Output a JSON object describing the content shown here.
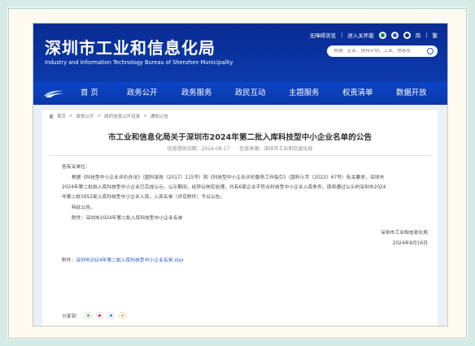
{
  "header": {
    "title": "深圳市工业和信息化局",
    "subtitle": "Industry and Information Technology Bureau of Shenzhen Municipality",
    "top_links": {
      "accessibility": "无障碍浏览",
      "care_mode": "进入关怀版",
      "simplified": "简",
      "traditional": "繁",
      "separator": "|"
    },
    "search": {
      "placeholder": "热搜：企业、扶持计划、工业、信息化"
    }
  },
  "nav": {
    "items": [
      "首 页",
      "政务公开",
      "政务服务",
      "政民互动",
      "主题服务",
      "权责清单",
      "数据开放"
    ]
  },
  "breadcrumb": {
    "items": [
      "首页",
      "政务公开",
      "政府信息公开目录",
      "通知公告"
    ],
    "separator": ">"
  },
  "article": {
    "title": "市工业和信息化局关于深圳市2024年第二批入库科技型中小企业名单的公告",
    "date_label": "信息提供日期：2024-08-17",
    "source_label": "信息来源：深圳市工业和信息化局",
    "greeting": "各有关单位：",
    "body_lines": [
      "根据《科技型中小企业评价办法》（国科发政〔2017〕115号）和《科技型中小企业评价服务工作指引》（国科火字〔2022〕67号）有关要求，深圳市",
      "2024年第二批拟入库科技型中小企业已完成公示。公示期间，经异议核实处理，共有6家企业不符合科技型中小企业入库条件。现将通过公示的深圳市2024",
      "年第二批5952家入库科技型中小企业入库，入库名单（详见附件）予以公告。"
    ],
    "closing": "特此公告。",
    "attachment_note": "附件：深圳市2024年第二批入库科技型中小企业名单",
    "signature": "深圳市工业和信息化局",
    "sign_date": "2024年8月16日",
    "attachment_label": "附件：",
    "attachment_file": "深圳市2024年第二批入库科技型中小企业名单.xlsx",
    "share_label": "分享到："
  },
  "colors": {
    "header_blue": "#0a2b93",
    "nav_blue": "#0c45c8",
    "link_blue": "#1f58c4",
    "background": "#d4ebe6"
  },
  "icons": [
    "weibo-icon",
    "wechat-icon",
    "app-icon",
    "search-icon",
    "home-icon",
    "share-wechat-icon",
    "share-weibo-icon",
    "share-qq-icon",
    "share-qzone-icon"
  ]
}
